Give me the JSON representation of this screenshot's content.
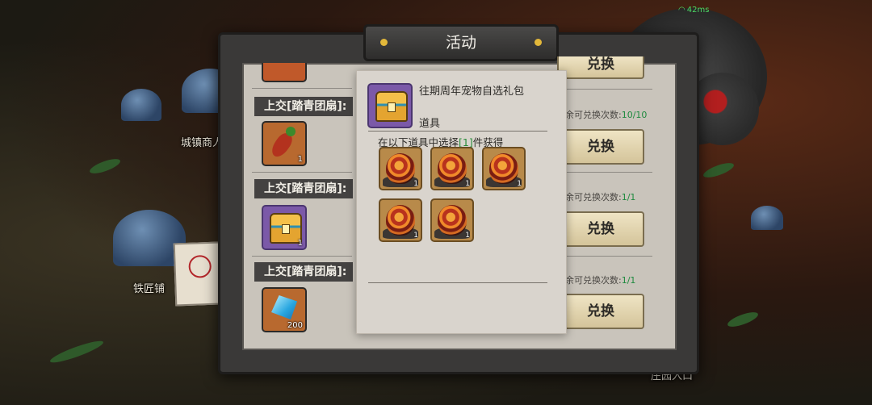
{
  "status": {
    "ping": "42ms"
  },
  "map": {
    "town_merchant": "城镇商人",
    "blacksmith": "铁匠铺",
    "manor_entrance": "庄园入口"
  },
  "window": {
    "title": "活动"
  },
  "rows": [
    {
      "label": "上交[踏青团扇]:",
      "item": "carrot",
      "count": "1"
    },
    {
      "label": "上交[踏青团扇]:",
      "item": "treasure-chest",
      "count": "1"
    },
    {
      "label": "上交[踏青团扇]:",
      "item": "blue-crystal",
      "count": "200"
    }
  ],
  "exchanges": [
    {
      "button": "兑换",
      "remain_label": "余可兑换次数:",
      "remain_value": "10/10",
      "top_button": "兑换"
    },
    {
      "button": "兑换",
      "remain_label": "余可兑换次数:",
      "remain_value": "1/1"
    },
    {
      "button": "兑换",
      "remain_label": "余可兑换次数:",
      "remain_value": "1/1"
    }
  ],
  "tooltip": {
    "item_name": "往期周年宠物自选礼包",
    "item_type": "道具",
    "choose_prefix": "在以下道具中选择",
    "choose_count": "[1]",
    "choose_suffix": "件获得",
    "rewards": [
      "1",
      "1",
      "1",
      "1",
      "1"
    ]
  }
}
